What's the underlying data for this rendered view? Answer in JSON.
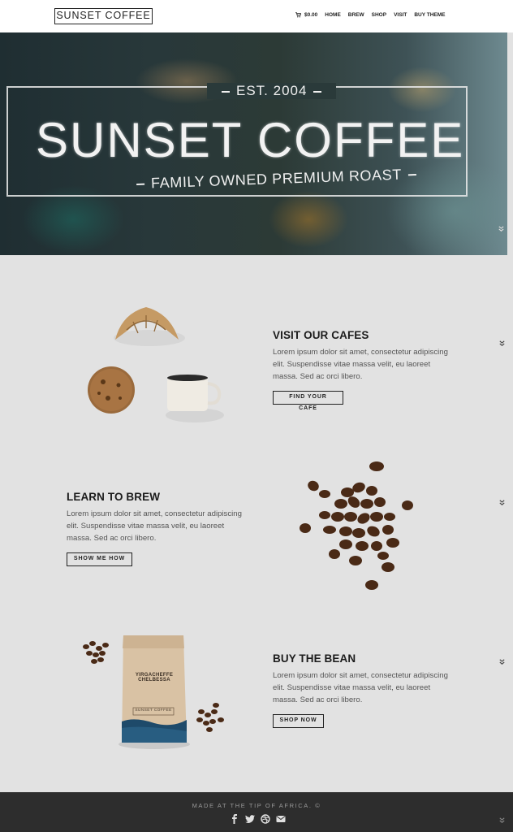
{
  "header": {
    "logo": "SUNSET COFFEE",
    "cart_total": "$0.00",
    "nav": [
      "HOME",
      "BREW",
      "SHOP",
      "VISIT",
      "BUY THEME"
    ]
  },
  "hero": {
    "est": "EST. 2004",
    "title": "SUNSET COFFEE",
    "subtitle": "FAMILY OWNED PREMIUM ROAST"
  },
  "sections": [
    {
      "title": "VISIT OUR CAFES",
      "body": "Lorem ipsum dolor sit amet, consectetur adipiscing elit. Suspendisse vitae massa velit, eu laoreet massa. Sed ac orci libero.",
      "button": "FIND YOUR CAFE"
    },
    {
      "title": "LEARN TO BREW",
      "body": "Lorem ipsum dolor sit amet, consectetur adipiscing elit. Suspendisse vitae massa velit, eu laoreet massa. Sed ac orci libero.",
      "button": "SHOW ME HOW"
    },
    {
      "title": "BUY THE BEAN",
      "body": "Lorem ipsum dolor sit amet, consectetur adipiscing elit. Suspendisse vitae massa velit, eu laoreet massa. Sed ac orci libero.",
      "button": "SHOP NOW"
    }
  ],
  "product": {
    "bag_name": "YIRGACHEFFE CHELBESSA",
    "bag_label": "SUNSET COFFEE"
  },
  "footer": {
    "text": "MADE AT THE TIP OF AFRICA. ©",
    "social_icons": [
      "facebook-icon",
      "twitter-icon",
      "dribbble-icon",
      "email-icon"
    ]
  },
  "colors": {
    "page_bg": "#e2e2e2",
    "header_bg": "#ffffff",
    "footer_bg": "#2d2d2d",
    "text_dark": "#1c1c1c"
  }
}
